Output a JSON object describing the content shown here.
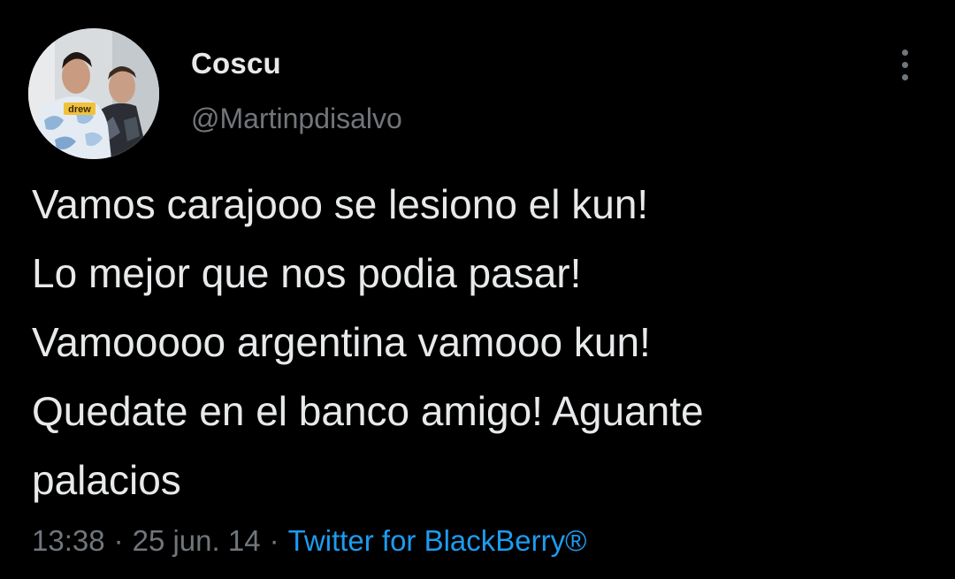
{
  "user": {
    "display_name": "Coscu",
    "handle": "@Martinpdisalvo"
  },
  "tweet": {
    "lines": [
      "Vamos carajooo se lesiono el kun!",
      "Lo mejor que nos podia pasar!",
      "Vamooooo argentina vamooo kun!",
      "Quedate en el banco amigo! Aguante",
      "palacios"
    ]
  },
  "meta": {
    "time": "13:38",
    "separator": "·",
    "date": "25 jun. 14",
    "source": "Twitter for BlackBerry®"
  },
  "icons": {
    "more": "more-vertical-icon"
  },
  "colors": {
    "background": "#000000",
    "text": "#e7e9ea",
    "secondary": "#71767b",
    "accent": "#1d9bf0"
  },
  "avatar_text": "drew"
}
